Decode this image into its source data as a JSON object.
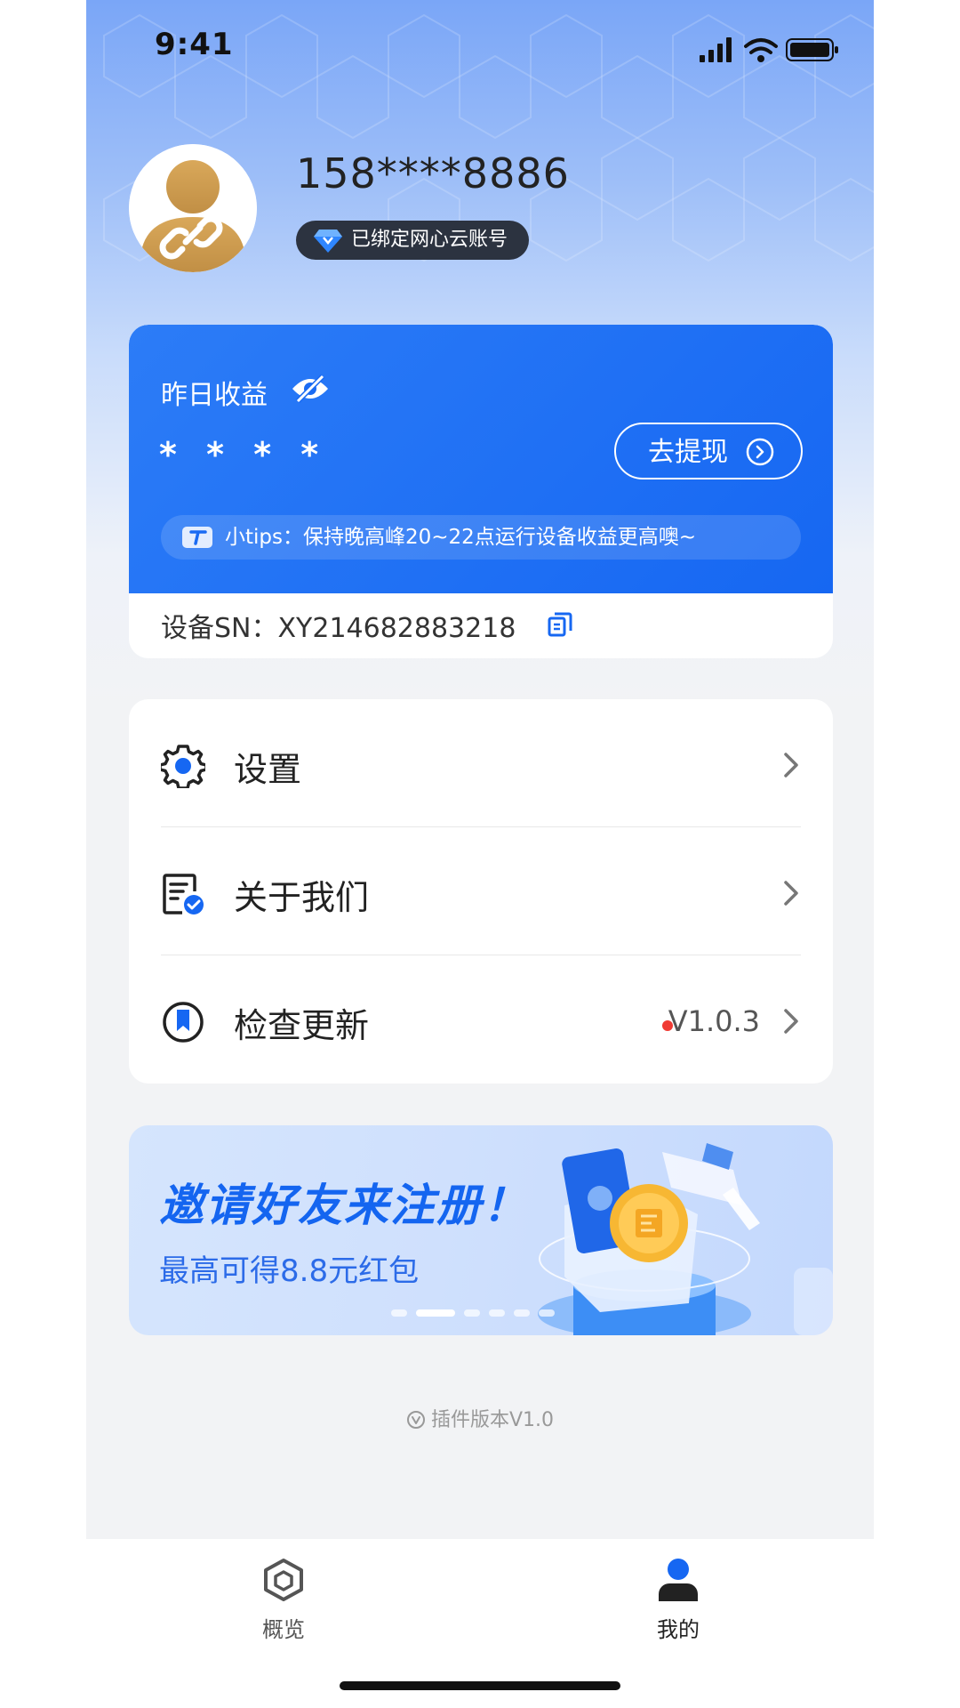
{
  "status_bar": {
    "time": "9:41"
  },
  "profile": {
    "phone": "158****8886",
    "bound_label": "已绑定网心云账号"
  },
  "earnings": {
    "label": "昨日收益",
    "value_masked": "* * * *",
    "withdraw_label": "去提现",
    "tips": "小tips：保持晚高峰20~22点运行设备收益更高噢~",
    "sn_label": "设备SN：XY214682883218"
  },
  "menu": {
    "items": [
      {
        "label": "设置",
        "icon": "gear-icon"
      },
      {
        "label": "关于我们",
        "icon": "document-check-icon"
      },
      {
        "label": "检查更新",
        "icon": "update-bookmark-icon",
        "version": "V1.0.3"
      }
    ]
  },
  "banner": {
    "title": "邀请好友来注册！",
    "subtitle": "最高可得8.8元红包",
    "slides": 6,
    "active_slide": 2
  },
  "footer": {
    "plugin_version": "插件版本V1.0"
  },
  "tabbar": {
    "tabs": [
      {
        "label": "概览",
        "active": false
      },
      {
        "label": "我的",
        "active": true
      }
    ]
  },
  "colors": {
    "primary": "#1667f2",
    "accent_red": "#f03a33",
    "dark": "#2c3340"
  }
}
